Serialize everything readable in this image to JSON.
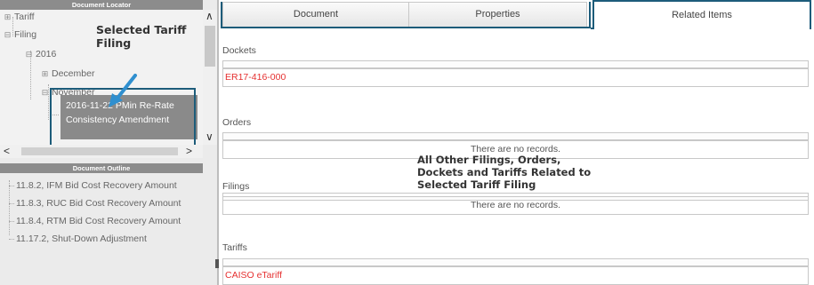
{
  "locator": {
    "header": "Document Locator",
    "tree": {
      "tariff": "Tariff",
      "filing": "Filing",
      "year": "2016",
      "december": "December",
      "november": "November",
      "selected_line1": "2016-11-22 PMin Re-Rate",
      "selected_line2": "Consistency Amendment"
    },
    "callout_title": "Selected Tariff Filing"
  },
  "outline": {
    "header": "Document Outline",
    "items": [
      "11.8.2, IFM Bid Cost Recovery Amount",
      "11.8.3, RUC Bid Cost Recovery Amount",
      "11.8.4, RTM Bid Cost Recovery Amount",
      "11.17.2, Shut-Down Adjustment"
    ]
  },
  "tabs": {
    "document": "Document",
    "properties": "Properties",
    "related": "Related Items"
  },
  "related": {
    "dockets_label": "Dockets",
    "dockets_value": "ER17-416-000",
    "orders_label": "Orders",
    "orders_empty": "There are no records.",
    "filings_label": "Filings",
    "filings_empty": "There are no records.",
    "tariffs_label": "Tariffs",
    "tariffs_value": "CAISO eTariff",
    "callout": "All Other Filings, Orders, Dockets and Tariffs Related to Selected Tariff Filing"
  },
  "colors": {
    "highlight_frame": "#1d5c7a",
    "link_red": "#e53030",
    "selected_bg": "#8a8a8a",
    "arrow_blue": "#2f8fcf"
  },
  "icons": [
    "expand-icon",
    "collapse-icon",
    "arrow-pointer-icon",
    "scroll-up-icon",
    "scroll-down-icon",
    "scroll-left-icon",
    "scroll-right-icon"
  ]
}
